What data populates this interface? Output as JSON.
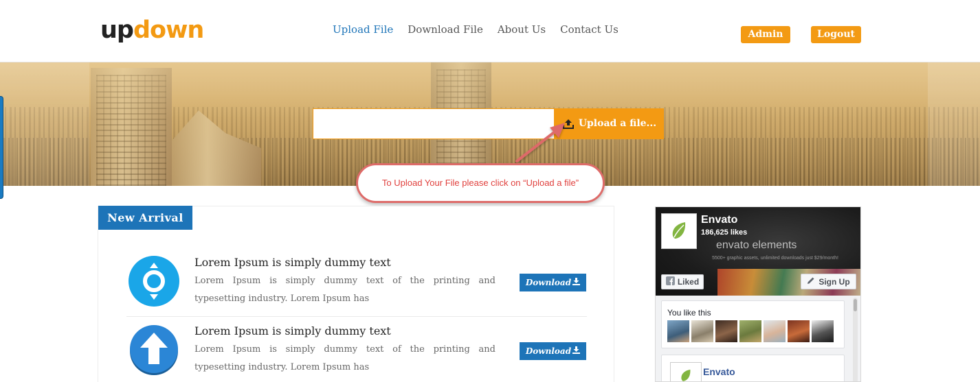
{
  "header": {
    "logo": {
      "up": "up",
      "down": "down"
    },
    "nav": [
      {
        "label": "Upload File",
        "active": true
      },
      {
        "label": "Download File",
        "active": false
      },
      {
        "label": "About Us",
        "active": false
      },
      {
        "label": "Contact Us",
        "active": false
      }
    ],
    "admin_label": "Admin",
    "logout_label": "Logout"
  },
  "hero": {
    "upload_value": "",
    "upload_button_label": "Upload a file...",
    "callout_text": "To Upload Your File please click on  “Upload a file”"
  },
  "new_arrival": {
    "title": "New Arrival",
    "items": [
      {
        "icon": "target-circle-icon",
        "title": "Lorem Ipsum is simply dummy text",
        "description": "Lorem Ipsum is simply dummy text of the printing and typesetting industry. Lorem Ipsum has",
        "button_label": "Download"
      },
      {
        "icon": "up-arrow-circle-icon",
        "title": "Lorem Ipsum is simply dummy text",
        "description": "Lorem Ipsum is simply dummy text of the printing and typesetting industry. Lorem Ipsum has",
        "button_label": "Download"
      }
    ]
  },
  "facebook": {
    "page_name": "Envato",
    "likes": "186,625 likes",
    "brand": "envato elements",
    "tagline": "5500+ graphic assets, unlimited downloads just $29/month!",
    "liked_label": "Liked",
    "signup_label": "Sign Up",
    "you_like_this": "You like this",
    "post_author": "Envato"
  },
  "colors": {
    "accent_orange": "#f39a13",
    "primary_blue": "#1d74b8",
    "callout_red": "#e0403d"
  }
}
